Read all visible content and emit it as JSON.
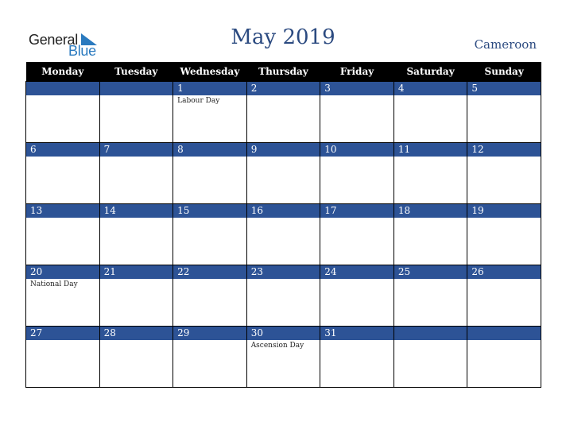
{
  "logo": {
    "word1": "General",
    "word2": "Blue"
  },
  "header": {
    "title": "May 2019",
    "country": "Cameroon"
  },
  "colors": {
    "accent": "#2d5396",
    "title": "#2b4a80",
    "logo_blue": "#2a7abf",
    "header_bg": "#000000"
  },
  "weekdays": [
    "Monday",
    "Tuesday",
    "Wednesday",
    "Thursday",
    "Friday",
    "Saturday",
    "Sunday"
  ],
  "weeks": [
    [
      {
        "day": "",
        "event": ""
      },
      {
        "day": "",
        "event": ""
      },
      {
        "day": "1",
        "event": "Labour Day"
      },
      {
        "day": "2",
        "event": ""
      },
      {
        "day": "3",
        "event": ""
      },
      {
        "day": "4",
        "event": ""
      },
      {
        "day": "5",
        "event": ""
      }
    ],
    [
      {
        "day": "6",
        "event": ""
      },
      {
        "day": "7",
        "event": ""
      },
      {
        "day": "8",
        "event": ""
      },
      {
        "day": "9",
        "event": ""
      },
      {
        "day": "10",
        "event": ""
      },
      {
        "day": "11",
        "event": ""
      },
      {
        "day": "12",
        "event": ""
      }
    ],
    [
      {
        "day": "13",
        "event": ""
      },
      {
        "day": "14",
        "event": ""
      },
      {
        "day": "15",
        "event": ""
      },
      {
        "day": "16",
        "event": ""
      },
      {
        "day": "17",
        "event": ""
      },
      {
        "day": "18",
        "event": ""
      },
      {
        "day": "19",
        "event": ""
      }
    ],
    [
      {
        "day": "20",
        "event": "National Day"
      },
      {
        "day": "21",
        "event": ""
      },
      {
        "day": "22",
        "event": ""
      },
      {
        "day": "23",
        "event": ""
      },
      {
        "day": "24",
        "event": ""
      },
      {
        "day": "25",
        "event": ""
      },
      {
        "day": "26",
        "event": ""
      }
    ],
    [
      {
        "day": "27",
        "event": ""
      },
      {
        "day": "28",
        "event": ""
      },
      {
        "day": "29",
        "event": ""
      },
      {
        "day": "30",
        "event": "Ascension Day"
      },
      {
        "day": "31",
        "event": ""
      },
      {
        "day": "",
        "event": ""
      },
      {
        "day": "",
        "event": ""
      }
    ]
  ]
}
